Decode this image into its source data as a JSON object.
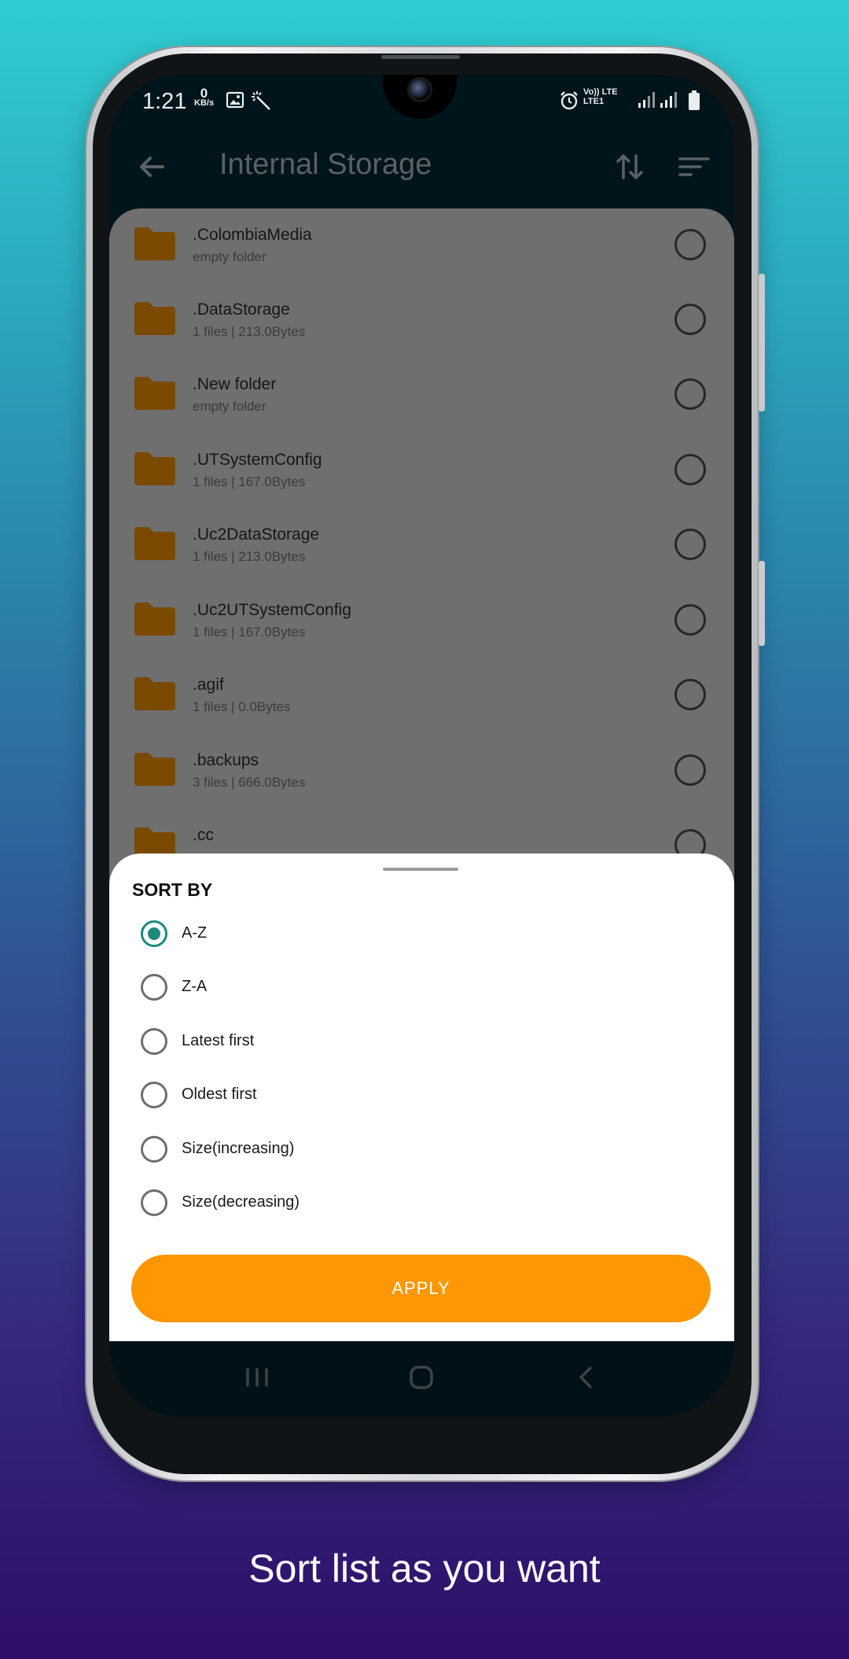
{
  "status_bar": {
    "time": "1:21",
    "net_speed_value": "0",
    "net_speed_unit": "KB/s",
    "signal_label_top": "Vo)) LTE",
    "signal_label_bottom": "LTE1"
  },
  "app_bar": {
    "title": "Internal Storage",
    "back_icon": "arrow-left-icon",
    "sort_icon": "sort-arrows-icon",
    "filter_icon": "filter-lines-icon"
  },
  "folders": [
    {
      "name": ".ColombiaMedia",
      "info": "empty folder"
    },
    {
      "name": ".DataStorage",
      "info": "1 files | 213.0Bytes"
    },
    {
      "name": ".New folder",
      "info": "empty folder"
    },
    {
      "name": ".UTSystemConfig",
      "info": "1 files | 167.0Bytes"
    },
    {
      "name": ".Uc2DataStorage",
      "info": "1 files | 213.0Bytes"
    },
    {
      "name": ".Uc2UTSystemConfig",
      "info": "1 files | 167.0Bytes"
    },
    {
      "name": ".agif",
      "info": "1 files | 0.0Bytes"
    },
    {
      "name": ".backups",
      "info": "3 files | 666.0Bytes"
    },
    {
      "name": ".cc",
      "info": ""
    }
  ],
  "sort_sheet": {
    "heading": "SORT BY",
    "options": [
      "A-Z",
      "Z-A",
      "Latest first",
      "Oldest first",
      "Size(increasing)",
      "Size(decreasing)"
    ],
    "selected_index": 0,
    "apply_label": "APPLY"
  },
  "colors": {
    "accent_selected": "#1a8a7c",
    "apply_button": "#fe9701",
    "folder": "#7a4a00"
  },
  "caption": "Sort list as you want"
}
